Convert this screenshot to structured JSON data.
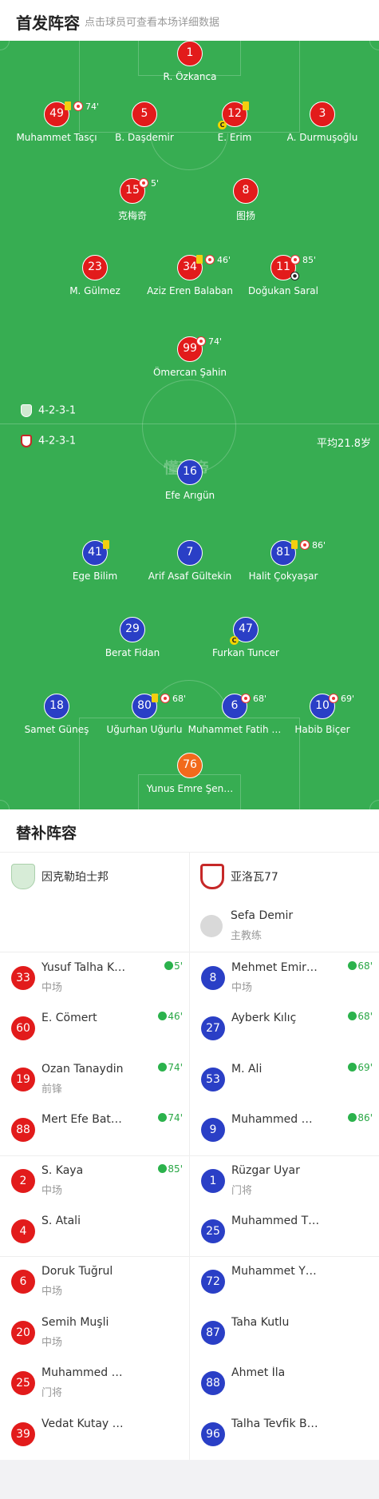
{
  "header": {
    "title": "首发阵容",
    "subtitle": "点击球员可查看本场详细数据"
  },
  "field": {
    "watermark": "懂球帝",
    "home_formation": "4-2-3-1",
    "away_formation": "4-2-3-1",
    "avg_age": "平均21.8岁"
  },
  "home_lineup": [
    {
      "num": "1",
      "name": "R. Özkanca"
    },
    {
      "num": "49",
      "name": "Muhammet Tasçı",
      "sub_min": "74'"
    },
    {
      "num": "5",
      "name": "B. Daşdemir"
    },
    {
      "num": "12",
      "name": "E. Erim",
      "captain": "C"
    },
    {
      "num": "3",
      "name": "A. Durmuşoğlu"
    },
    {
      "num": "15",
      "name": "克梅奇",
      "sub_min": "5'"
    },
    {
      "num": "8",
      "name": "图扬"
    },
    {
      "num": "23",
      "name": "M. Gülmez"
    },
    {
      "num": "34",
      "name": "Aziz Eren Balaban",
      "sub_min": "46'"
    },
    {
      "num": "11",
      "name": "Doğukan Saral",
      "sub_min": "85'"
    },
    {
      "num": "99",
      "name": "Ömercan Şahin",
      "sub_min": "74'"
    }
  ],
  "away_lineup": [
    {
      "num": "16",
      "name": "Efe Arıgün"
    },
    {
      "num": "41",
      "name": "Ege Bilim"
    },
    {
      "num": "7",
      "name": "Arif Asaf Gültekin"
    },
    {
      "num": "81",
      "name": "Halit Çokyaşar",
      "sub_min": "86'"
    },
    {
      "num": "29",
      "name": "Berat Fidan"
    },
    {
      "num": "47",
      "name": "Furkan Tuncer",
      "captain": "C"
    },
    {
      "num": "18",
      "name": "Samet Güneş"
    },
    {
      "num": "80",
      "name": "Uğurhan Uğurlu",
      "sub_min": "68'"
    },
    {
      "num": "6",
      "name": "Muhammet Fatih …",
      "sub_min": "68'"
    },
    {
      "num": "10",
      "name": "Habib Biçer",
      "sub_min": "69'"
    },
    {
      "num": "76",
      "name": "Yunus Emre Şen…"
    }
  ],
  "bench": {
    "title": "替补阵容",
    "home_team": "因克勒珀士邦",
    "away_team": "亚洛瓦77",
    "away_coach": {
      "name": "Sefa Demir",
      "role": "主教练"
    },
    "home": [
      {
        "num": "33",
        "name": "Yusuf Talha K…",
        "role": "中场",
        "sub": "5'"
      },
      {
        "num": "60",
        "name": "E. Cömert",
        "role": "",
        "sub": "46'"
      },
      {
        "num": "19",
        "name": "Ozan Tanaydin",
        "role": "前锋",
        "sub": "74'"
      },
      {
        "num": "88",
        "name": "Mert Efe Bat…",
        "role": "",
        "sub": "74'"
      },
      {
        "num": "2",
        "name": "S. Kaya",
        "role": "中场",
        "sub": "85'"
      },
      {
        "num": "4",
        "name": "S. Atali",
        "role": "",
        "sub": ""
      },
      {
        "num": "6",
        "name": "Doruk Tuğrul",
        "role": "中场",
        "sub": ""
      },
      {
        "num": "20",
        "name": "Semih Muşli",
        "role": "中场",
        "sub": ""
      },
      {
        "num": "25",
        "name": "Muhammed …",
        "role": "门将",
        "sub": ""
      },
      {
        "num": "39",
        "name": "Vedat Kutay …",
        "role": "",
        "sub": ""
      }
    ],
    "away": [
      {
        "num": "8",
        "name": "Mehmet Emir…",
        "role": "中场",
        "sub": "68'"
      },
      {
        "num": "27",
        "name": "Ayberk Kılıç",
        "role": "",
        "sub": "68'"
      },
      {
        "num": "53",
        "name": "M. Ali",
        "role": "",
        "sub": "69'"
      },
      {
        "num": "9",
        "name": "Muhammed …",
        "role": "",
        "sub": "86'"
      },
      {
        "num": "1",
        "name": "Rüzgar Uyar",
        "role": "门将",
        "sub": ""
      },
      {
        "num": "25",
        "name": "Muhammed T…",
        "role": "",
        "sub": ""
      },
      {
        "num": "72",
        "name": "Muhammet Y…",
        "role": "",
        "sub": ""
      },
      {
        "num": "87",
        "name": "Taha Kutlu",
        "role": "",
        "sub": ""
      },
      {
        "num": "88",
        "name": "Ahmet İla",
        "role": "",
        "sub": ""
      },
      {
        "num": "96",
        "name": "Talha Tevfik B…",
        "role": "",
        "sub": ""
      }
    ]
  },
  "colors": {
    "pitch": "#37ad52",
    "home": "#e21b1b",
    "away": "#2a3fc6",
    "keeper_away": "#f26a1b",
    "sub_green": "#2bb24c"
  }
}
